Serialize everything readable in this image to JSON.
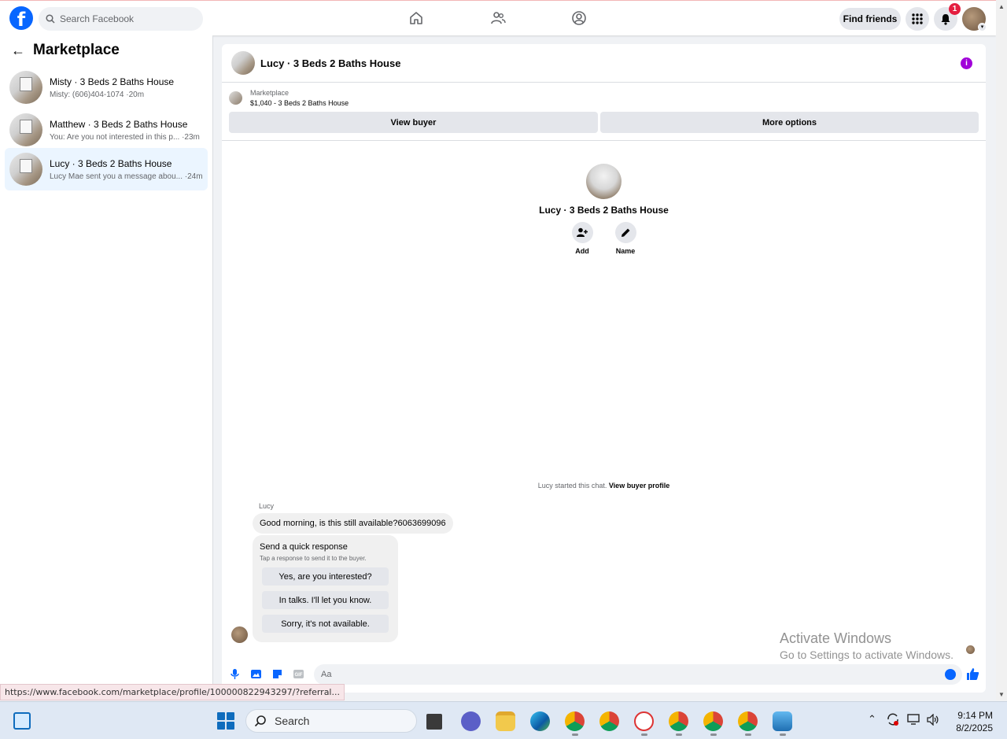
{
  "topnav": {
    "logo_letter": "f",
    "search_placeholder": "Search Facebook",
    "find_friends": "Find friends",
    "notification_count": "1"
  },
  "sidebar": {
    "title": "Marketplace",
    "conversations": [
      {
        "title": "Misty · 3 Beds 2 Baths House",
        "preview": "Misty: (606)404-1074 ·20m",
        "active": false
      },
      {
        "title": "Matthew · 3 Beds 2 Baths House",
        "preview": "You: Are you not interested in this p... ·23m",
        "active": false
      },
      {
        "title": "Lucy · 3 Beds 2 Baths House",
        "preview": "Lucy Mae sent you a message abou... ·24m",
        "active": true
      }
    ]
  },
  "chat": {
    "title": "Lucy · 3 Beds 2 Baths House",
    "listing_source": "Marketplace",
    "listing_price": "$1,040 - 3 Beds 2 Baths House",
    "view_buyer": "View buyer",
    "more_options": "More options",
    "profile_name": "Lucy · 3 Beds 2 Baths House",
    "add_label": "Add",
    "name_label": "Name",
    "started_text": "Lucy started this chat.",
    "view_buyer_profile": "View buyer profile",
    "sender": "Lucy",
    "message": "Good morning, is this still available?6063699096",
    "quick_title": "Send a quick response",
    "quick_sub": "Tap a response to send it to the buyer.",
    "quick_replies": [
      "Yes, are you interested?",
      "In talks. I'll let you know.",
      "Sorry, it's not available."
    ],
    "composer_placeholder": "Aa"
  },
  "watermark": {
    "line1": "Activate Windows",
    "line2": "Go to Settings to activate Windows."
  },
  "status_url": "https://www.facebook.com/marketplace/profile/100000822943297/?referral...",
  "taskbar": {
    "search_label": "Search",
    "time": "9:14 PM",
    "date": "8/2/2025"
  },
  "colors": {
    "facebook_blue": "#0866ff",
    "active_conversation": "#ebf5ff",
    "info_purple": "#a100d9",
    "badge_red": "#e41e3f"
  }
}
